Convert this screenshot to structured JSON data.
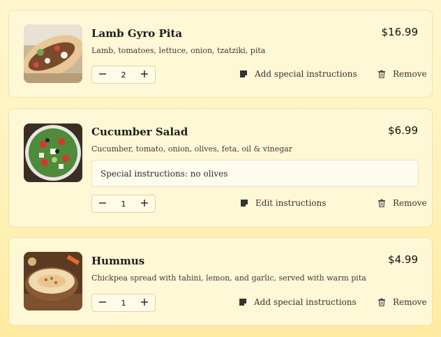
{
  "items": [
    {
      "title": "Lamb Gyro Pita",
      "description": "Lamb, tomatoes, lettuce, onion, tzatziki, pita",
      "price": "$16.99",
      "quantity": "2",
      "instructions_action": "Add special instructions",
      "remove_label": "Remove"
    },
    {
      "title": "Cucumber Salad",
      "description": "Cucumber, tomato, onion, olives, feta, oil & vinegar",
      "price": "$6.99",
      "quantity": "1",
      "special_instructions": "Special instructions: no olives",
      "instructions_action": "Edit instructions",
      "remove_label": "Remove"
    },
    {
      "title": "Hummus",
      "description": "Chickpea spread with tahini, lemon, and garlic, served with warm pita",
      "price": "$4.99",
      "quantity": "1",
      "instructions_action": "Add special instructions",
      "remove_label": "Remove"
    }
  ],
  "icons": {
    "minus": "minus-icon",
    "plus": "plus-icon",
    "note": "note-icon",
    "trash": "trash-icon"
  }
}
